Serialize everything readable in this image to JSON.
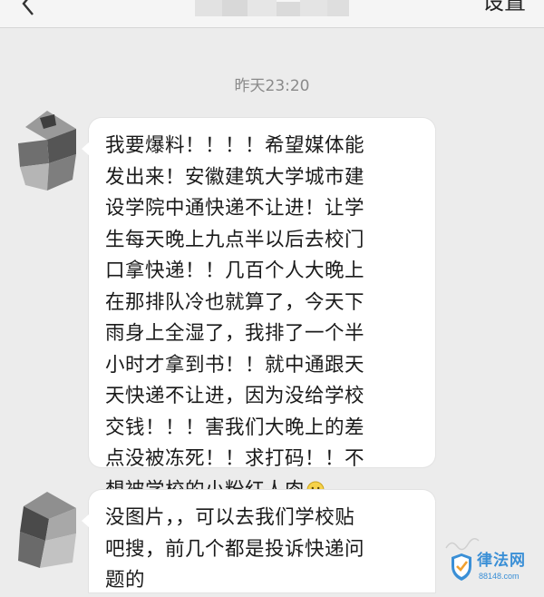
{
  "header": {
    "back_icon": "chevron-left-icon",
    "settings_label": "设置"
  },
  "conversation": {
    "timestamp": "昨天23:20",
    "messages": [
      {
        "lines": [
          "我要爆料！！！！希望媒体能",
          "发出来！安徽建筑大学城市建",
          "设学院中通快递不让进！让学",
          "生每天晚上九点半以后去校门",
          "口拿快递！！几百个人大晚上",
          "在那排队冷也就算了，今天下",
          "雨身上全湿了，我排了一个半",
          "小时才拿到书！！就中通跟天",
          "天快递不让进，因为没给学校",
          "交钱！！！害我们大晚上的差",
          "点没被冻死！！求打码！！不",
          "想被学校的小粉红人肉"
        ],
        "emoji": "awkward-smile-emoji"
      },
      {
        "lines": [
          "没图片，，可以去我们学校贴",
          "吧搜，前几个都是投诉快递问",
          "题的"
        ]
      }
    ]
  },
  "watermark": {
    "title": "律法网",
    "url": "88148.com",
    "colors": {
      "brand": "#3a8fd6",
      "accent": "#f0a030"
    }
  },
  "colors": {
    "background": "#ececec",
    "bubble": "#ffffff",
    "timestamp": "#8a8a8a"
  }
}
